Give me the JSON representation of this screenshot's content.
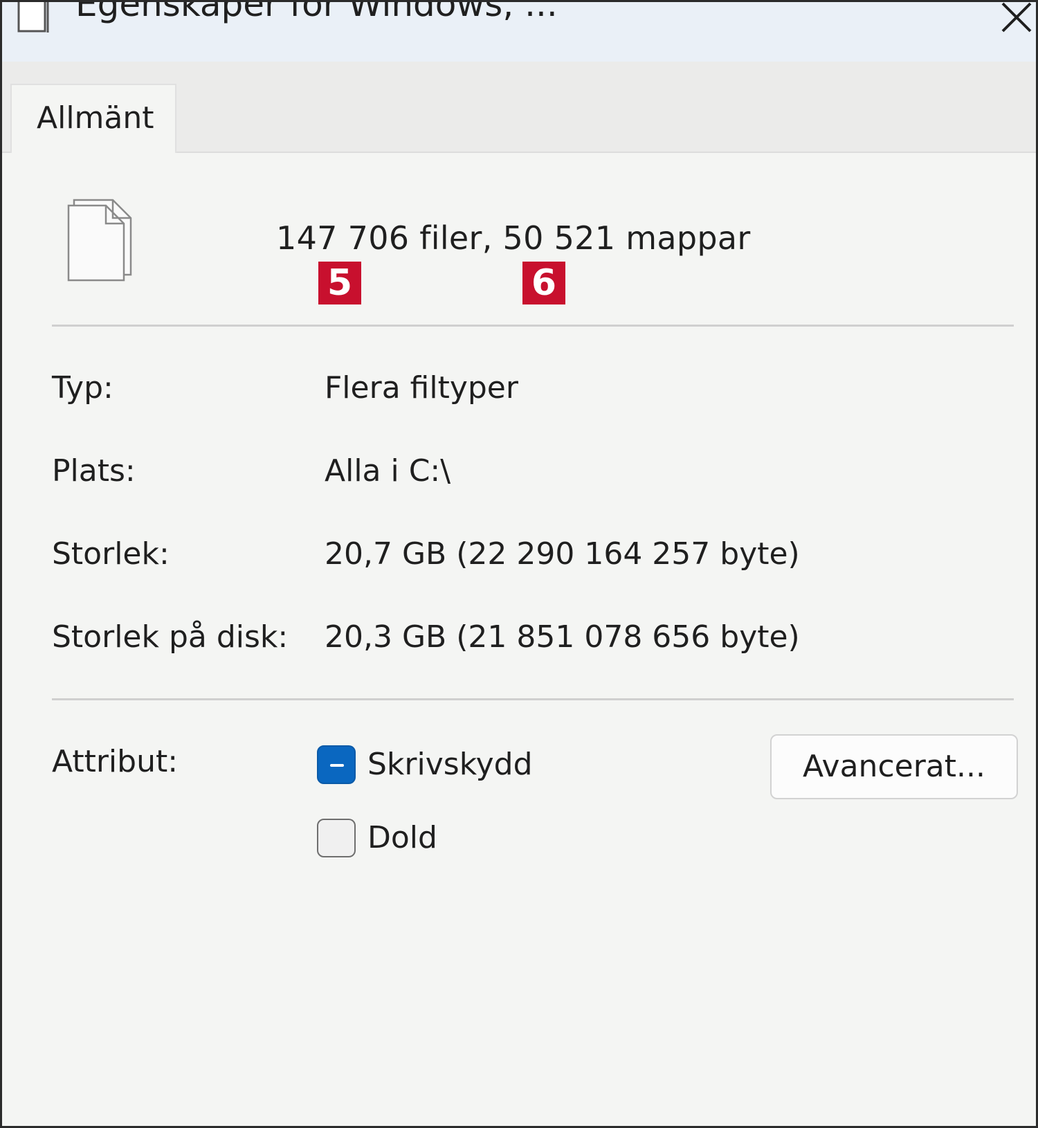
{
  "window": {
    "title": "Egenskaper för Windows, ..."
  },
  "tabs": [
    {
      "label": "Allmänt",
      "active": true
    }
  ],
  "summary": {
    "text": "147 706 filer, 50 521 mappar",
    "markers": [
      "5",
      "6"
    ],
    "marker_color": "#c8102e"
  },
  "properties": {
    "type": {
      "label": "Typ:",
      "value": "Flera filtyper"
    },
    "location": {
      "label": "Plats:",
      "value": "Alla i C:\\"
    },
    "size": {
      "label": "Storlek:",
      "value": "20,7 GB (22 290 164 257 byte)"
    },
    "size_on_disk": {
      "label": "Storlek på disk:",
      "value": "20,3 GB (21 851 078 656 byte)"
    }
  },
  "attributes": {
    "label": "Attribut:",
    "readonly": {
      "label": "Skrivskydd",
      "state": "indeterminate"
    },
    "hidden": {
      "label": "Dold",
      "state": "unchecked"
    },
    "advanced_button": "Avancerat..."
  },
  "colors": {
    "accent": "#0a67c0",
    "dialog_bg": "#f4f5f3"
  },
  "icons": {
    "title": "document-icon",
    "close": "close-icon",
    "files": "multiple-files-icon"
  }
}
